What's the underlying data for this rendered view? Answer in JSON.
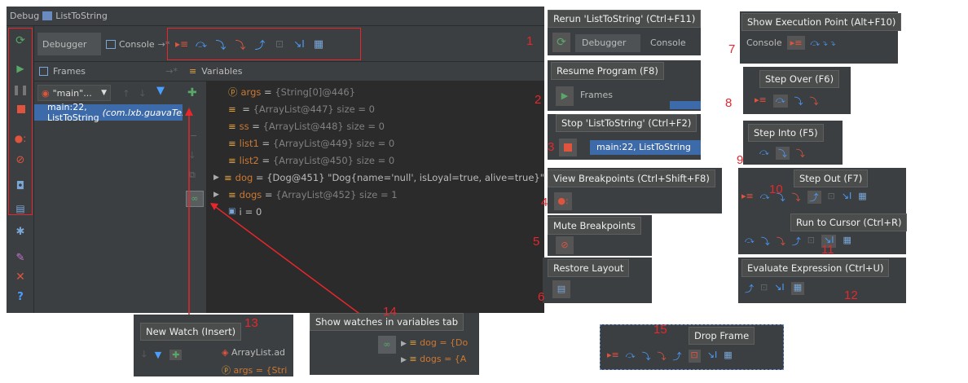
{
  "main": {
    "title": "Debug",
    "config": "ListToString",
    "tabs": [
      {
        "label": "Debugger"
      },
      {
        "label": "Console"
      }
    ],
    "frames_label": "Frames",
    "variables_label": "Variables",
    "thread": "\"main\"...",
    "frame": "main:22, ListToString",
    "frame_pkg": "(com.lxb.guavaTest)",
    "vars": [
      {
        "name": "args",
        "val": "{String[0]@446}",
        "icon": "p"
      },
      {
        "name": "",
        "val": "{ArrayList@447}  size = 0",
        "icon": "list"
      },
      {
        "name": "ss",
        "val": "{ArrayList@448}  size = 0",
        "icon": "list"
      },
      {
        "name": "list1",
        "val": "{ArrayList@449}  size = 0",
        "icon": "list"
      },
      {
        "name": "list2",
        "val": "{ArrayList@450}  size = 0",
        "icon": "list"
      },
      {
        "name": "dog",
        "val": "{Dog@451} \"Dog{name='null', isLoyal=true, alive=true}\"",
        "icon": "list"
      },
      {
        "name": "dogs",
        "val": "{ArrayList@452}  size = 1",
        "icon": "list"
      },
      {
        "name": "i",
        "val": "= 0",
        "icon": "i"
      }
    ]
  },
  "tooltips": {
    "rerun": "Rerun 'ListToString' (Ctrl+F11)",
    "resume": "Resume Program (F8)",
    "stop": "Stop 'ListToString' (Ctrl+F2)",
    "view_bp": "View Breakpoints (Ctrl+Shift+F8)",
    "mute_bp": "Mute Breakpoints",
    "restore": "Restore Layout",
    "show_exec": "Show Execution Point (Alt+F10)",
    "step_over": "Step Over (F6)",
    "step_into": "Step Into (F5)",
    "step_out": "Step Out (F7)",
    "run_cursor": "Run to Cursor (Ctrl+R)",
    "evaluate": "Evaluate Expression (Ctrl+U)",
    "new_watch": "New Watch (Insert)",
    "show_watches": "Show watches in variables tab",
    "drop_frame": "Drop Frame"
  },
  "crops": {
    "debugger": "Debugger",
    "console": "Console",
    "frames": "Frames",
    "frame": "main:22, ListToString",
    "arraylist": "ArrayList.ad",
    "args": "args = {Stri",
    "dog": "dog = {Do",
    "dogs": "dogs = {A"
  },
  "numbers": [
    "1",
    "2",
    "3",
    "4",
    "5",
    "6",
    "7",
    "8",
    "9",
    "10",
    "11",
    "12",
    "13",
    "14",
    "15"
  ]
}
